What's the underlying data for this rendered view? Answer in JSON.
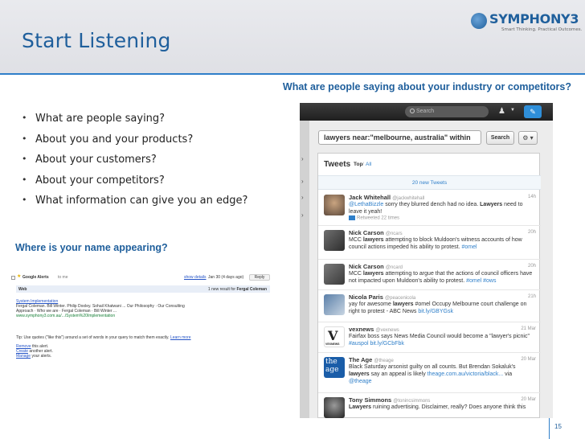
{
  "slide": {
    "title": "Start Listening",
    "subheading": "What are people saying about your industry or competitors?",
    "bullets": [
      "What are people saying?",
      "About you and your products?",
      "About your customers?",
      "About your competitors?",
      "What information can give you an edge?"
    ],
    "name_heading": "Where is your name appearing?",
    "page_number": "15"
  },
  "logo": {
    "name": "SYMPHONY3",
    "tagline": "Smart Thinking. Practical Outcomes.",
    "icon": "globe-icon"
  },
  "google_alert": {
    "from": "Google Alerts",
    "to": "to me",
    "show_details": "show details",
    "date": "Jan 30 (4 days ago)",
    "reply": "Reply",
    "section": "Web",
    "result_prefix": "1 new result for",
    "result_term": "Fergal Coleman",
    "link_title": "System Implementation",
    "snippet_1": "Fergal Coleman. Bill Winter. Philip Dooley. Sohail Khatwani ... Our Philosophy · Our Consulting",
    "snippet_2": "Approach · Who we are · Fergal Coleman · Bill Winter ...",
    "url": "www.symphony3.com.au/.../System%20Implementation",
    "tip": "Tip: Use quotes (\"like this\") around a set of words in your query to match them exactly.",
    "learn_more": "Learn more",
    "remove_link": "Remove",
    "remove_rest": " this alert.",
    "create_link": "Create",
    "create_rest": " another alert.",
    "manage_link": "Manage",
    "manage_rest": " your alerts."
  },
  "twitter": {
    "search_placeholder": "Search",
    "query": "lawyers near:\"melbourne, australia\" within",
    "search_button": "Search",
    "panel_title": "Tweets",
    "filter_top": "Top",
    "filter_sep": "/",
    "filter_all": "All",
    "new_tweets": "20 new Tweets",
    "tweets": [
      {
        "name": "Jack Whitehall",
        "handle": "@jackwhitehall",
        "time": "14h",
        "mention": "@LethaBizzle",
        "text_a": " sorry they blurred dench had no idea. ",
        "highlight": "Lawyers",
        "text_b": " need to leave it yeah!",
        "retweeted": "Retweeted 22 times"
      },
      {
        "name": "Nick Carson",
        "handle": "@ncars",
        "time": "20h",
        "text_a": "MCC ",
        "highlight": "lawyers",
        "text_b": " attempting to block Muldoon's witness accounts of how council actions impeded his ability to protest. ",
        "tag": "#omel"
      },
      {
        "name": "Nick Carson",
        "handle": "@ncard",
        "time": "20h",
        "text_a": "MCC ",
        "highlight": "lawyers",
        "text_b": " attempting to argue that the actions of council officers have not impacted upon Muldoon's ability to protest. ",
        "tag": "#omel #ows"
      },
      {
        "name": "Nicola Paris",
        "handle": "@peacenicola",
        "time": "21h",
        "text_a": "yay for awesome ",
        "highlight": "lawyers",
        "text_b": " #omel Occupy Melbourne court challenge on right to protest - ABC News ",
        "tag": "bit.ly/GBYGsk"
      },
      {
        "name": "vexnews",
        "handle": "@vexnews",
        "time": "21 Mar",
        "text_a": "Fairfax boss says News Media Council would become a \"lawyer's picnic\" ",
        "tag": "#auspol bit.ly/GCbFbk",
        "avatar_letter": "V",
        "avatar_label": "VEXNEWS"
      },
      {
        "name": "The Age",
        "handle": "@theage",
        "time": "20 Mar",
        "text_a": "Black Saturday arsonist guilty on all counts. But Brendan Sokaluk's ",
        "highlight": "lawyers",
        "text_b": " say an appeal is likely ",
        "tag": "theage.com.au/victoria/black...",
        "text_c": " via ",
        "mention": "@theage",
        "avatar_text": "the age"
      },
      {
        "name": "Tony Simmons",
        "handle": "@tonincsimmons",
        "time": "20 Mar",
        "highlight": "Lawyers",
        "text_b": " ruining advertising. Disclaimer, really? Does anyone think this"
      }
    ]
  },
  "colors": {
    "brand_blue": "#1f5f9c",
    "accent_blue": "#2f7fc9",
    "header_bg": "#e4e5ea",
    "twitter_dark": "#2a2a2a"
  }
}
